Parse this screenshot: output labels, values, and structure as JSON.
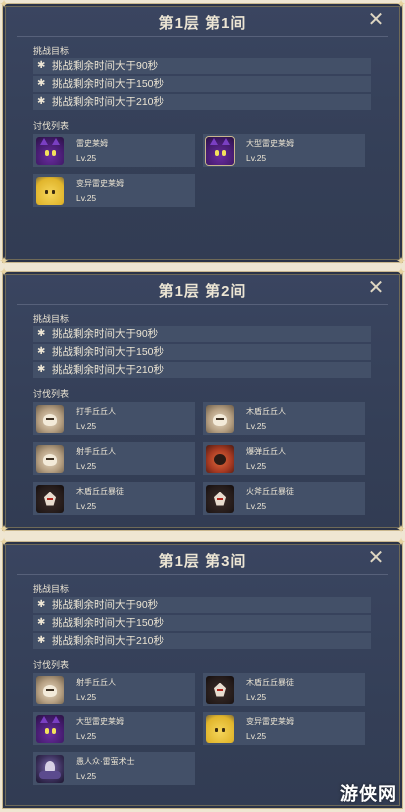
{
  "panels": [
    {
      "title": "第1层 第1间",
      "goals_label": "挑战目标",
      "goals": [
        "挑战剩余时间大于90秒",
        "挑战剩余时间大于150秒",
        "挑战剩余时间大于210秒"
      ],
      "enemies_label": "讨伐列表",
      "enemies": [
        {
          "name": "雷史莱姆",
          "level": "Lv.25",
          "icon": "electro-slime-icon"
        },
        {
          "name": "大型雷史莱姆",
          "level": "Lv.25",
          "icon": "large-electro-slime-icon"
        },
        {
          "name": "变异雷史莱姆",
          "level": "Lv.25",
          "icon": "mutant-electro-slime-icon"
        }
      ]
    },
    {
      "title": "第1层 第2间",
      "goals_label": "挑战目标",
      "goals": [
        "挑战剩余时间大于90秒",
        "挑战剩余时间大于150秒",
        "挑战剩余时间大于210秒"
      ],
      "enemies_label": "讨伐列表",
      "enemies": [
        {
          "name": "打手丘丘人",
          "level": "Lv.25",
          "icon": "hilichurl-fighter-icon"
        },
        {
          "name": "木盾丘丘人",
          "level": "Lv.25",
          "icon": "wooden-shieldwall-hilichurl-icon"
        },
        {
          "name": "射手丘丘人",
          "level": "Lv.25",
          "icon": "hilichurl-shooter-icon"
        },
        {
          "name": "爆弹丘丘人",
          "level": "Lv.25",
          "icon": "pyro-hilichurl-icon"
        },
        {
          "name": "木盾丘丘暴徒",
          "level": "Lv.25",
          "icon": "wooden-shield-mitachurl-icon"
        },
        {
          "name": "火斧丘丘暴徒",
          "level": "Lv.25",
          "icon": "blazing-axe-mitachurl-icon"
        }
      ]
    },
    {
      "title": "第1层 第3间",
      "goals_label": "挑战目标",
      "goals": [
        "挑战剩余时间大于90秒",
        "挑战剩余时间大于150秒",
        "挑战剩余时间大于210秒"
      ],
      "enemies_label": "讨伐列表",
      "enemies": [
        {
          "name": "射手丘丘人",
          "level": "Lv.25",
          "icon": "hilichurl-shooter-icon"
        },
        {
          "name": "木盾丘丘暴徒",
          "level": "Lv.25",
          "icon": "wooden-shield-mitachurl-icon"
        },
        {
          "name": "大型雷史莱姆",
          "level": "Lv.25",
          "icon": "large-electro-slime-icon"
        },
        {
          "name": "变异雷史莱姆",
          "level": "Lv.25",
          "icon": "mutant-electro-slime-icon"
        },
        {
          "name": "愚人众·雷萤术士",
          "level": "Lv.25",
          "icon": "electro-cicin-mage-icon"
        }
      ]
    }
  ],
  "watermark": "游侠网",
  "colors": {
    "panel_bg": "#3a4560",
    "row_bg": "#435068",
    "border": "#c9b78e",
    "text": "#ece5d4"
  }
}
